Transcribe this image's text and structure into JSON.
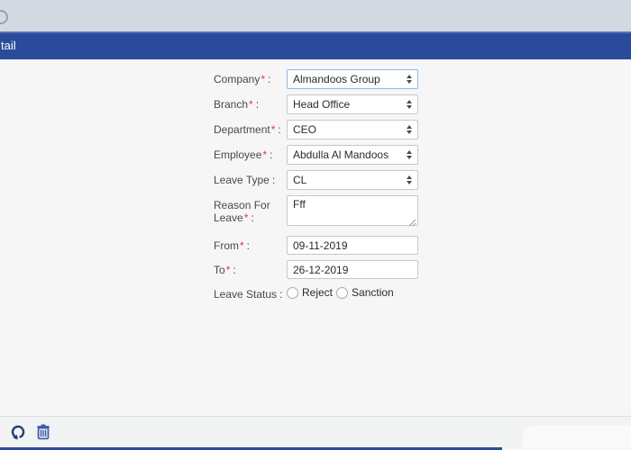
{
  "header": {
    "title": "tail"
  },
  "colors": {
    "header_blue": "#2a4b9b",
    "top_band_gray": "#d4dae1",
    "required_red": "#e03a3a",
    "focused_border_blue": "#8fb6e4"
  },
  "form": {
    "label_suffix": ":",
    "required_marker": "*",
    "company": {
      "label": "Company",
      "value": "Almandoos Group"
    },
    "branch": {
      "label": "Branch",
      "value": "Head Office"
    },
    "department": {
      "label": "Department",
      "value": "CEO"
    },
    "employee": {
      "label": "Employee",
      "value": "Abdulla Al Mandoos"
    },
    "leave_type": {
      "label": "Leave Type",
      "value": "CL"
    },
    "reason": {
      "label": "Reason For Leave",
      "value": "Fff"
    },
    "from": {
      "label": "From",
      "value": "09-11-2019"
    },
    "to": {
      "label": "To",
      "value": "26-12-2019"
    },
    "leave_status": {
      "label": "Leave Status",
      "options": [
        "Reject",
        "Sanction"
      ]
    }
  },
  "footer": {
    "icons": {
      "refresh": "circular-arrow-refresh",
      "delete": "trash-can"
    }
  }
}
